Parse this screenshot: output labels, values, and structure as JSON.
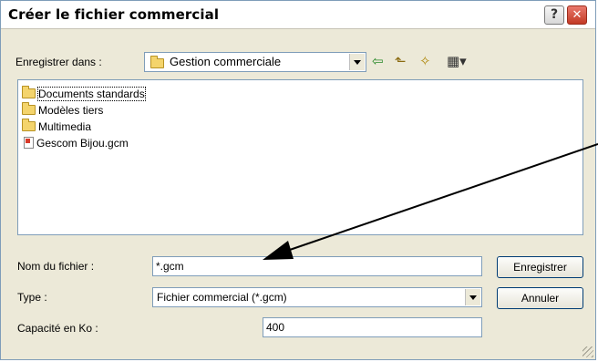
{
  "window": {
    "title": "Créer le fichier commercial"
  },
  "titlebar": {
    "help_glyph": "?",
    "close_glyph": "✕"
  },
  "save_in": {
    "label": "Enregistrer dans :",
    "value": "Gestion commerciale"
  },
  "toolbar": {
    "back_glyph": "⇦",
    "up_glyph": "⬑",
    "newfolder_glyph": "✧",
    "view_glyph": "▦▾"
  },
  "files": [
    {
      "name": "Documents standards",
      "type": "folder"
    },
    {
      "name": "Modèles tiers",
      "type": "folder"
    },
    {
      "name": "Multimedia",
      "type": "folder"
    },
    {
      "name": "Gescom Bijou.gcm",
      "type": "gcm-file"
    }
  ],
  "filename": {
    "label": "Nom du fichier :",
    "value": "*.gcm"
  },
  "filetype": {
    "label": "Type :",
    "value": "Fichier commercial (*.gcm)"
  },
  "capacity": {
    "label": "Capacité en Ko :",
    "value": "400"
  },
  "buttons": {
    "save": "Enregistrer",
    "cancel": "Annuler"
  },
  "colors": {
    "window_bg": "#ece9d8",
    "border": "#7f9db9",
    "close": "#c33a24"
  }
}
